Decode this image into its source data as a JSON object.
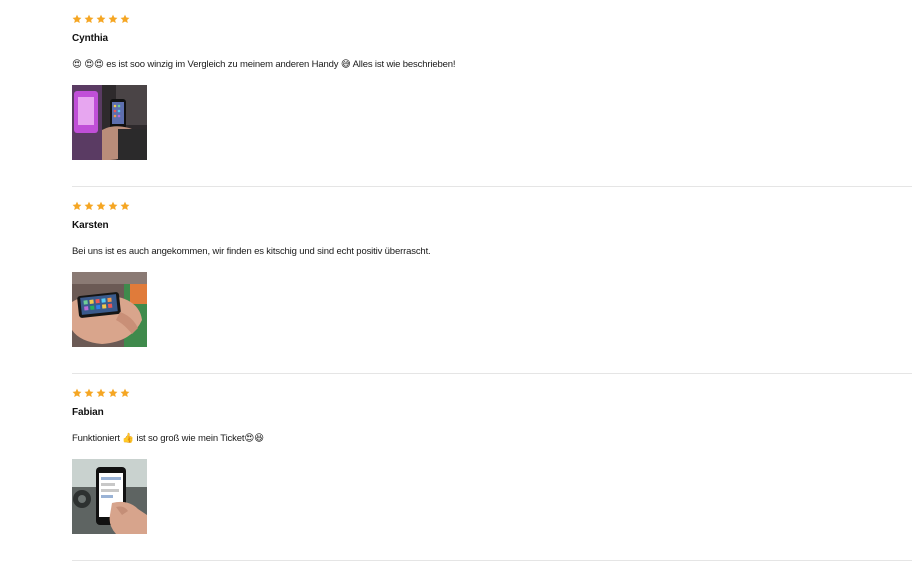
{
  "colors": {
    "star": "#f5a623",
    "divider": "#e5e5e5",
    "text": "#111111"
  },
  "reviews": [
    {
      "rating": 5,
      "name": "Cynthia",
      "text": "😍 😍😍 es ist soo winzig im Vergleich zu meinem anderen Handy 😅 Alles ist wie beschrieben!",
      "photo": "photo-hand-holding-small-phone-purple"
    },
    {
      "rating": 5,
      "name": "Karsten",
      "text": "Bei uns ist es auch angekommen, wir finden es kitschig und sind echt positiv überrascht.",
      "photo": "photo-hand-holding-small-phone-palm"
    },
    {
      "rating": 5,
      "name": "Fabian",
      "text": "Funktioniert 👍 ist so groß wie mein Ticket😍😆",
      "photo": "photo-hand-holding-phone-in-car"
    }
  ]
}
